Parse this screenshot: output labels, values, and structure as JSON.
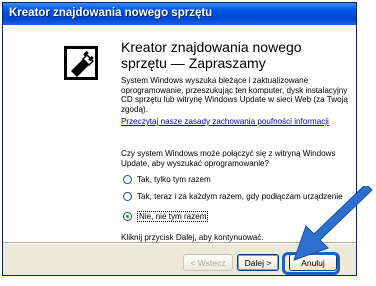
{
  "window": {
    "title": "Kreator znajdowania nowego sprzętu"
  },
  "wizard": {
    "heading": "Kreator znajdowania nowego sprzętu — Zapraszamy",
    "intro": "System Windows wyszuka bieżące i zaktualizowane oprogramowanie, przeszukując ten komputer, dysk instalacyjny CD sprzętu lub witrynę Windows Update w sieci Web (za Twoją zgodą).",
    "privacy_link": "Przeczytaj nasze zasady zachowania poufności informacji",
    "question": "Czy system Windows może połączyć się z witryną Windows Update, aby wyszukać oprogramowanie?",
    "options": [
      {
        "label": "Tak, tylko tym razem",
        "selected": false
      },
      {
        "label": "Tak, teraz i za każdym razem, gdy podłączam urządzenie",
        "selected": false
      },
      {
        "label": "Nie, nie tym razem",
        "selected": true
      }
    ],
    "continue_text": "Kliknij przycisk Dalej, aby kontynuować."
  },
  "buttons": {
    "back": "< Wstecz",
    "next": "Dalej >",
    "cancel": "Anuluj"
  },
  "colors": {
    "titlebar": "#0054e3",
    "highlight": "#1f5fbf"
  }
}
